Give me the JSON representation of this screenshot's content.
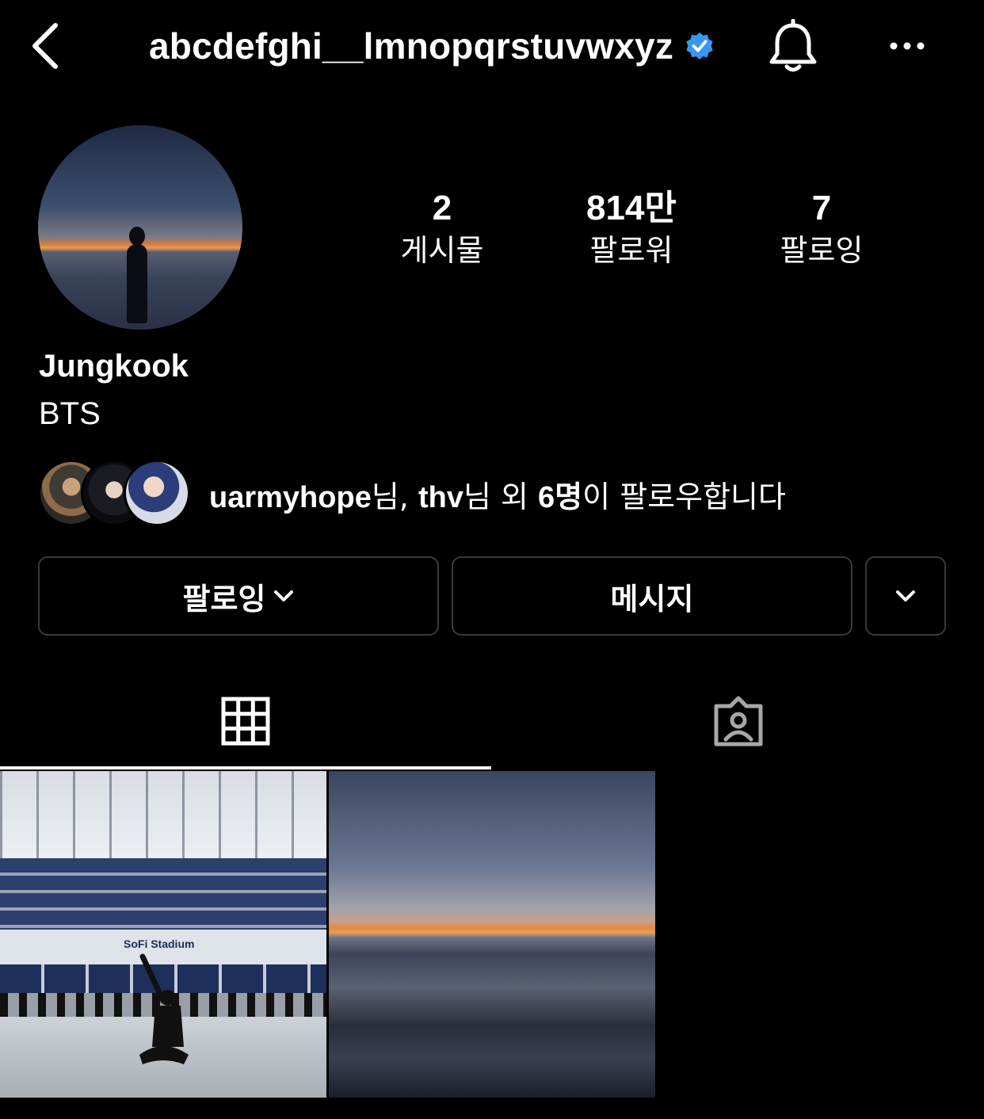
{
  "header": {
    "username": "abcdefghi__lmnopqrstuvwxyz",
    "verified_icon": "verified-badge-icon",
    "back_icon": "chevron-left-icon",
    "bell_icon": "bell-icon",
    "more_icon": "more-horizontal-icon",
    "accent_color": "#3897f0"
  },
  "profile": {
    "name": "Jungkook",
    "bio": "BTS",
    "stats": [
      {
        "value": "2",
        "label": "게시물"
      },
      {
        "value": "814만",
        "label": "팔로워"
      },
      {
        "value": "7",
        "label": "팔로잉"
      }
    ]
  },
  "followed_by": {
    "user1": "uarmyhope",
    "suffix1": "님, ",
    "user2": "thv",
    "suffix2": "님 외 ",
    "count": "6명",
    "suffix3": "이 팔로우합니다"
  },
  "buttons": {
    "follow_label": "팔로잉",
    "message_label": "메시지"
  },
  "post1": {
    "banner_text": "SoFi Stadium"
  },
  "tabs": {
    "grid_icon": "grid-icon",
    "tagged_icon": "tagged-person-icon"
  }
}
